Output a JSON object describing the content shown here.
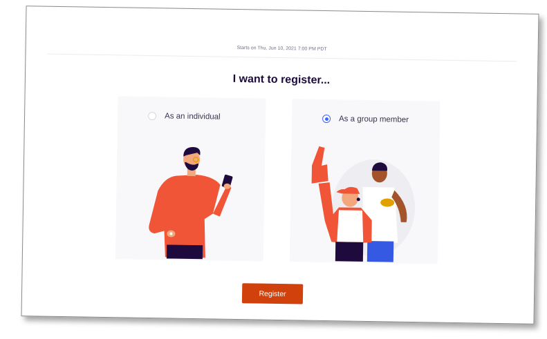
{
  "event": {
    "starts_on": "Starts on Thu, Jun 10, 2021 7:00 PM PDT"
  },
  "heading": "I want to register...",
  "options": [
    {
      "label": "As an individual",
      "selected": false
    },
    {
      "label": "As a group member",
      "selected": true
    }
  ],
  "register_label": "Register",
  "colors": {
    "accent_orange": "#d1410c",
    "radio_blue": "#3d64ff",
    "heading": "#1e0a3c",
    "illustration_orange": "#f05537"
  },
  "icons": [
    "radio-unchecked-icon",
    "radio-checked-icon",
    "individual-illustration",
    "group-illustration"
  ]
}
